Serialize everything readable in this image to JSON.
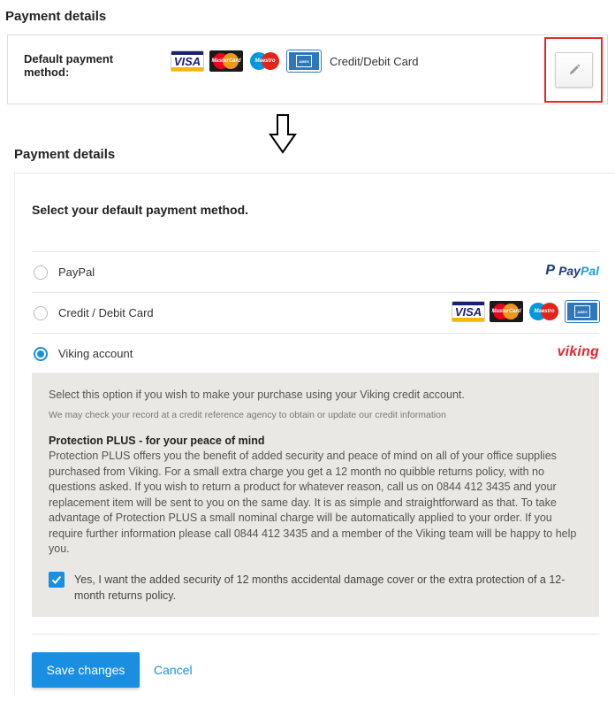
{
  "top": {
    "title": "Payment details",
    "default_label": "Default payment method:",
    "method_type": "Credit/Debit Card",
    "card_logos": [
      "VISA",
      "MasterCard",
      "Maestro",
      "American Express"
    ]
  },
  "bottom": {
    "title": "Payment details",
    "select_heading": "Select your default payment method.",
    "options": [
      {
        "label": "PayPal",
        "selected": false,
        "logo_pay": "Pay",
        "logo_pal": "Pal"
      },
      {
        "label": "Credit / Debit Card",
        "selected": false
      },
      {
        "label": "Viking account",
        "selected": true,
        "logo_text": "viking"
      }
    ],
    "viking_panel": {
      "line1": "Select this option if you wish to make your purchase using your Viking credit account.",
      "line2": "We may check your record at a credit reference agency to obtain or update our credit information",
      "heading": "Protection PLUS - for your peace of mind",
      "body": "Protection PLUS offers you the benefit of added security and peace of mind on all of your office supplies purchased from Viking. For a small extra charge you get a 12 month no quibble returns policy, with no questions asked. If you wish to return a product for whatever reason, call us on 0844 412 3435 and your replacement item will be sent to you on the same day. It is as simple and straightforward as that. To take advantage of Protection PLUS a small nominal charge will be automatically applied to your order. If you require further information please call 0844 412 3435 and a member of the Viking team will be happy to help you.",
      "checkbox_checked": true,
      "checkbox_label": "Yes, I want the added security of 12 months accidental damage cover or the extra protection of a 12-month returns policy."
    },
    "save_label": "Save changes",
    "cancel_label": "Cancel"
  },
  "colors": {
    "accent": "#1a8ee1",
    "highlight": "#e32b2b",
    "panel_bg": "#e9e8e5",
    "viking_red": "#e3262f"
  }
}
